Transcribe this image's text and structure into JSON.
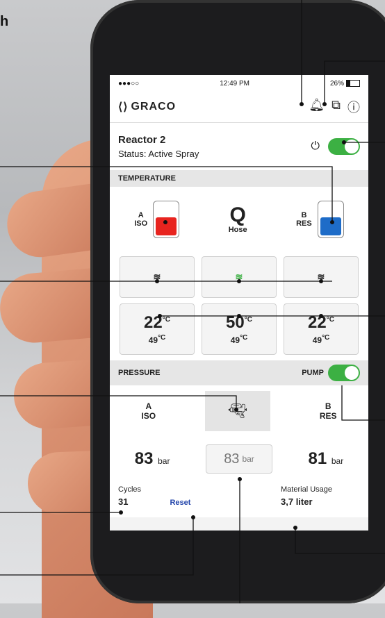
{
  "status_bar": {
    "signal": "●●●○○",
    "time": "12:49 PM",
    "battery": "26%"
  },
  "header": {
    "brand": "GRACO",
    "icons": [
      "bell-icon",
      "document-1-icon",
      "info-icon"
    ]
  },
  "device": {
    "name": "Reactor 2",
    "status": "Status: Active Spray",
    "power_on": true
  },
  "temperature": {
    "section_title": "TEMPERATURE",
    "tank_a": {
      "letter": "A",
      "label": "ISO",
      "color": "#e8241f"
    },
    "hose": {
      "symbol": "Q",
      "label": "Hose"
    },
    "tank_b": {
      "letter": "B",
      "label": "RES",
      "color": "#1e6cc8"
    },
    "heat_buttons": [
      "heater-a-icon",
      "heater-hose-icon",
      "heater-b-icon"
    ],
    "zones": [
      {
        "actual": "22",
        "setpoint": "49",
        "unit": "°C"
      },
      {
        "actual": "50",
        "setpoint": "49",
        "unit": "°C"
      },
      {
        "actual": "22",
        "setpoint": "49",
        "unit": "°C"
      }
    ]
  },
  "pressure": {
    "section_title": "PRESSURE",
    "pump_label": "PUMP",
    "pump_on": true,
    "a": {
      "letter": "A",
      "label": "ISO",
      "value": "83",
      "unit": "bar"
    },
    "b": {
      "letter": "B",
      "label": "RES",
      "value": "81",
      "unit": "bar"
    },
    "middle": {
      "value": "83",
      "unit": "bar"
    }
  },
  "cycles": {
    "label": "Cycles",
    "value": "31",
    "reset": "Reset"
  },
  "material": {
    "label": "Material Usage",
    "value": "3,7 liter"
  },
  "background_text": {
    "heading_fragment": "h",
    "icon_fragment": "("
  }
}
